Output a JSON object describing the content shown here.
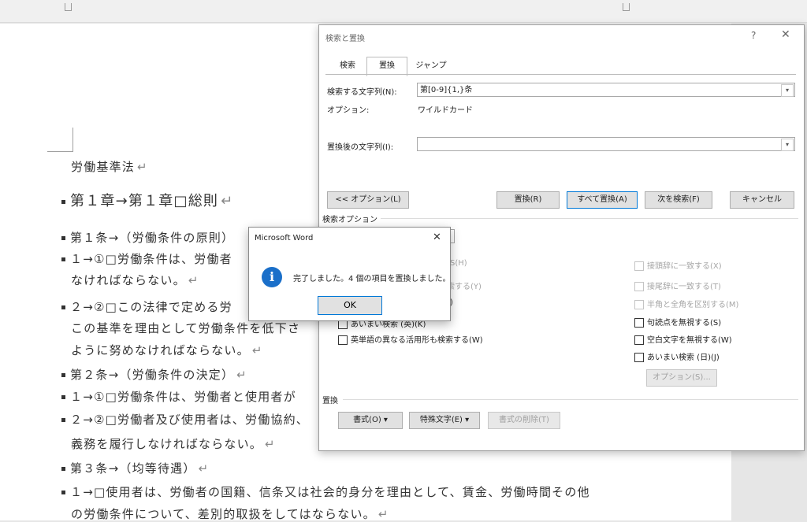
{
  "document": {
    "title": "労働基準法",
    "lines": [
      "第１章→第１章□総則",
      "第１条→（労働条件の原則）",
      "１→①□労働条件は、労働者",
      "なければならない。",
      "２→②□この法律で定める労",
      "この基準を理由として労働条件を低下さ",
      "ように努めなければならない。",
      "第２条→（労働条件の決定）",
      "１→①□労働条件は、労働者と使用者が",
      "２→②□労働者及び使用者は、労働協約、",
      "義務を履行しなければならない。",
      "第３条→（均等待遇）",
      "１→□使用者は、労働者の国籍、信条又は社会的身分を理由として、賃金、労働時間その他",
      "の労働条件について、差別的取扱をしてはならない。"
    ],
    "paragraph_mark": "↵"
  },
  "find_replace_dialog": {
    "title": "検索と置換",
    "help": "?",
    "close": "✕",
    "tabs": [
      "検索",
      "置換",
      "ジャンプ"
    ],
    "find_label": "検索する文字列(N):",
    "find_value": "第[0-9]{1,}条",
    "options_label": "オプション:",
    "options_value": "ワイルドカード",
    "replace_label": "置換後の文字列(I):",
    "replace_value": "",
    "buttons": {
      "less_options": "<< オプション(L)",
      "replace": "置換(R)",
      "replace_all": "すべて置換(A)",
      "find_next": "次を検索(F)",
      "cancel": "キャンセル"
    },
    "search_options_header": "検索オプション",
    "left_options_partial": [
      "S(H)",
      "検索する(Y)",
      ")"
    ],
    "left_options": [
      "あいまい検索 (英)(K)",
      "英単語の異なる活用形も検索する(W)"
    ],
    "right_options": [
      "接頭辞に一致する(X)",
      "接尾辞に一致する(T)",
      "半角と全角を区別する(M)",
      "句読点を無視する(S)",
      "空白文字を無視する(W)",
      "あいまい検索 (日)(J)"
    ],
    "options_button": "オプション(S)...",
    "replace_section_header": "置換",
    "bottom_buttons": [
      "書式(O) ▾",
      "特殊文字(E) ▾",
      "書式の削除(T)"
    ]
  },
  "message_box": {
    "title": "Microsoft Word",
    "close": "✕",
    "icon": "info-icon",
    "icon_glyph": "i",
    "text": "完了しました。4 個の項目を置換しました。",
    "ok": "OK"
  },
  "colors": {
    "accent": "#0078d7",
    "info_icon": "#1a6fc9"
  }
}
